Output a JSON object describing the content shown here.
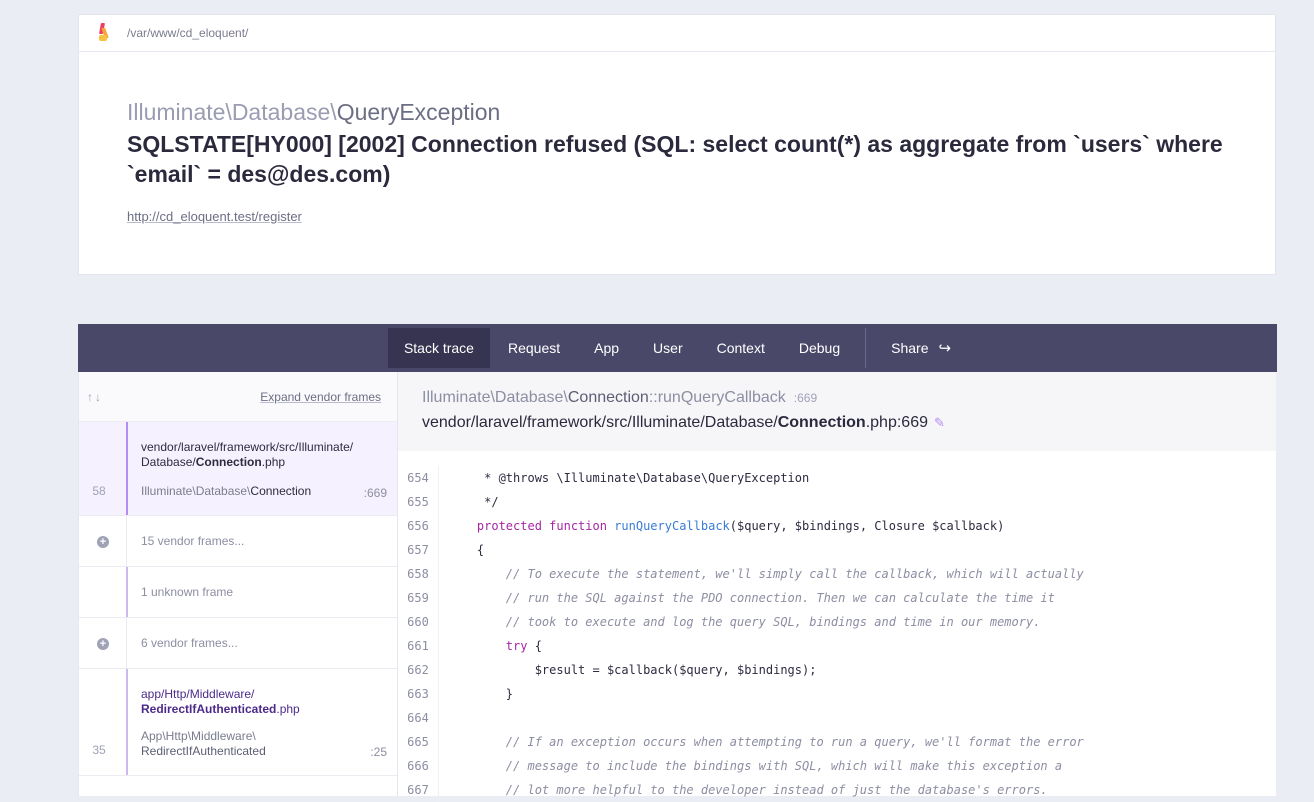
{
  "header": {
    "path": "/var/www/cd_eloquent/",
    "exception_namespace": "Illuminate\\Database\\",
    "exception_class": "QueryException",
    "message": "SQLSTATE[HY000] [2002] Connection refused (SQL: select count(*) as aggregate from `users` where `email` = des@des.com)",
    "url": "http://cd_eloquent.test/register"
  },
  "tabs": {
    "stack_trace": "Stack trace",
    "request": "Request",
    "app": "App",
    "user": "User",
    "context": "Context",
    "debug": "Debug",
    "share": "Share"
  },
  "sidebar": {
    "arrows": "↑↓",
    "expand": "Expand vendor frames",
    "frames": [
      {
        "num": "58",
        "path1": "vendor/laravel/framework/src/Illuminate/",
        "path2_pre": "Database/",
        "path2_file": "Connection",
        "path2_ext": ".php",
        "class_pre": "Illuminate\\Database\\",
        "class_name": "Connection",
        "line": ":669"
      },
      {
        "label": "15 vendor frames..."
      },
      {
        "label": "1 unknown frame"
      },
      {
        "label": "6 vendor frames..."
      },
      {
        "num": "35",
        "path1": "app/Http/Middleware/",
        "path2_file": "RedirectIfAuthenticated",
        "path2_ext": ".php",
        "class1": "App\\Http\\Middleware\\",
        "class2": "RedirectIfAuthenticated",
        "line": ":25"
      }
    ]
  },
  "frame_detail": {
    "class_pre": "Illuminate\\Database\\",
    "class_name": "Connection",
    "method": "::runQueryCallback",
    "line": ":669",
    "file_pre": "vendor/laravel/framework/src/Illuminate/Database/",
    "file_name": "Connection",
    "file_ext": ".php:669"
  },
  "code": {
    "lines": [
      {
        "n": "654",
        "t": "     * @throws \\Illuminate\\Database\\QueryException"
      },
      {
        "n": "655",
        "t": "     */"
      },
      {
        "n": "656",
        "pre": "    ",
        "kw": "protected function",
        "fn": "runQueryCallback",
        "rest": "($query, $bindings, Closure $callback)"
      },
      {
        "n": "657",
        "t": "    {"
      },
      {
        "n": "658",
        "c": "        // To execute the statement, we'll simply call the callback, which will actually"
      },
      {
        "n": "659",
        "c": "        // run the SQL against the PDO connection. Then we can calculate the time it"
      },
      {
        "n": "660",
        "c": "        // took to execute and log the query SQL, bindings and time in our memory."
      },
      {
        "n": "661",
        "pre": "        ",
        "kw": "try",
        "rest": " {"
      },
      {
        "n": "662",
        "t": "            $result = $callback($query, $bindings);"
      },
      {
        "n": "663",
        "t": "        }"
      },
      {
        "n": "664",
        "t": ""
      },
      {
        "n": "665",
        "c": "        // If an exception occurs when attempting to run a query, we'll format the error"
      },
      {
        "n": "666",
        "c": "        // message to include the bindings with SQL, which will make this exception a"
      },
      {
        "n": "667",
        "c": "        // lot more helpful to the developer instead of just the database's errors."
      }
    ]
  }
}
